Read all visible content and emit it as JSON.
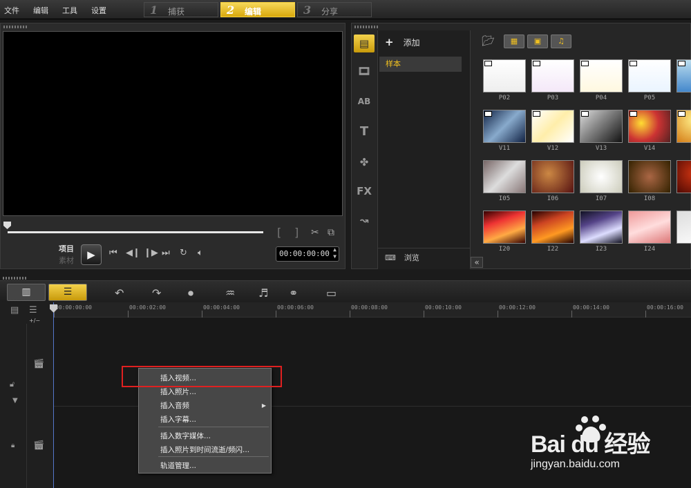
{
  "menu": {
    "file": "文件",
    "edit": "编辑",
    "tools": "工具",
    "settings": "设置"
  },
  "steps": [
    {
      "num": "1",
      "label": "捕获"
    },
    {
      "num": "2",
      "label": "编辑"
    },
    {
      "num": "3",
      "label": "分享"
    }
  ],
  "player": {
    "mode_project": "项目",
    "mode_clip": "素材",
    "bracket_in": "[",
    "bracket_out": "]",
    "timecode": "00:00:00:00",
    "play_icon": "play-icon"
  },
  "library": {
    "add_label": "添加",
    "add_symbol": "+",
    "folder_sample": "样本",
    "browse_label": "浏览",
    "collapse_symbol": "«",
    "tab_ab": "AB",
    "tab_t": "T",
    "tab_fx": "FX",
    "thumbnails": [
      {
        "label": "P02"
      },
      {
        "label": "P03"
      },
      {
        "label": "P04"
      },
      {
        "label": "P05"
      },
      {
        "label": "V11"
      },
      {
        "label": "V12"
      },
      {
        "label": "V13"
      },
      {
        "label": "V14"
      },
      {
        "label": "I05"
      },
      {
        "label": "I06"
      },
      {
        "label": "I07"
      },
      {
        "label": "I08"
      },
      {
        "label": "I20"
      },
      {
        "label": "I22"
      },
      {
        "label": "I23"
      },
      {
        "label": "I24"
      }
    ]
  },
  "timeline": {
    "track_add": "+/−",
    "ticks": [
      "00:00:00:00",
      "00:00:02:00",
      "00:00:04:00",
      "00:00:06:00",
      "00:00:08:00",
      "00:00:10:00",
      "00:00:12:00",
      "00:00:14:00",
      "00:00:16:00"
    ]
  },
  "context_menu": {
    "insert_video": "插入视频...",
    "insert_photo": "插入照片...",
    "insert_audio": "插入音频",
    "insert_subtitle": "插入字幕...",
    "insert_digital_media": "插入数字媒体...",
    "insert_photo_timelapse": "插入照片到时间流逝/频闪...",
    "track_manager": "轨道管理..."
  },
  "watermark": {
    "logo": "Bai du 经验",
    "url": "jingyan.baidu.com"
  },
  "colors": {
    "accent": "#f0c020",
    "highlight": "#e02020"
  }
}
